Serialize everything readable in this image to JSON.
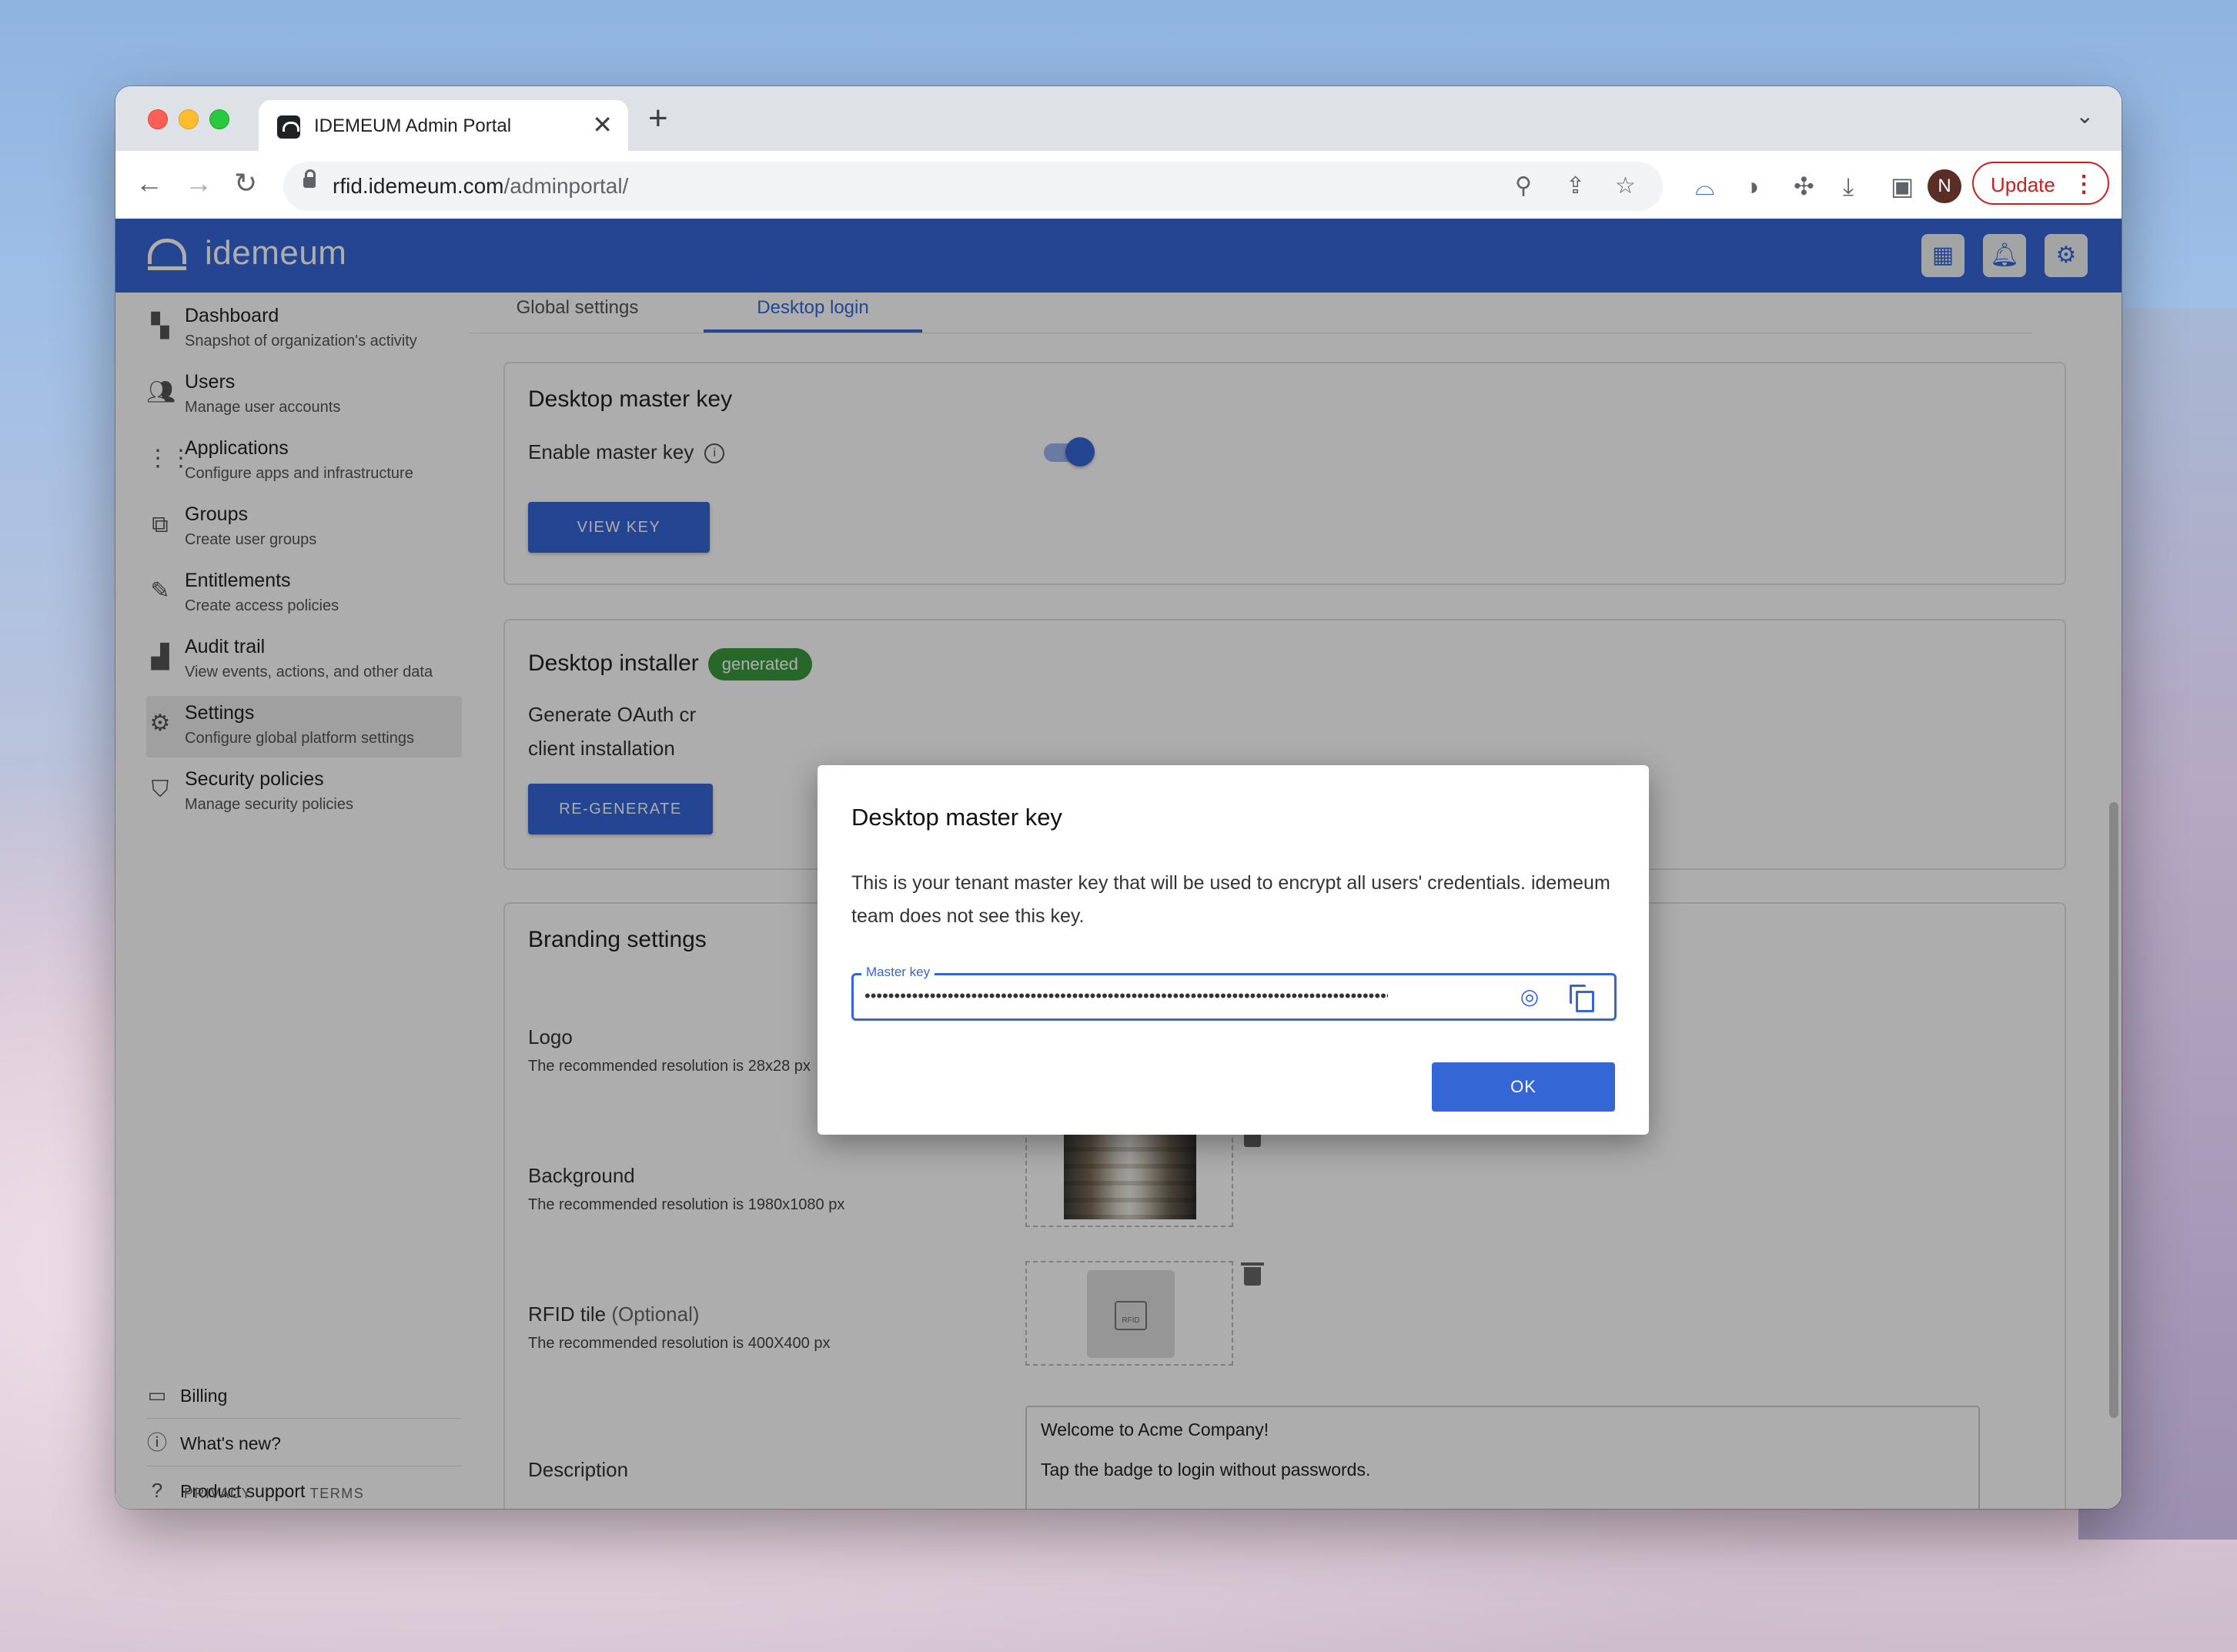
{
  "browser": {
    "tab_title": "IDEMEUM Admin Portal",
    "tab_close": "✕",
    "new_tab": "+",
    "tab_menu": "⌄",
    "url_host": "rfid.idemeum.com",
    "url_path": "/adminportal/",
    "profile_initial": "N",
    "update_label": "Update",
    "update_menu": "⋮"
  },
  "app": {
    "brand": "idemeum",
    "accent_color": "#3566d6"
  },
  "sidebar": {
    "items": [
      {
        "title": "Dashboard",
        "sub": "Snapshot of organization's activity",
        "icon": "dashboard-icon"
      },
      {
        "title": "Users",
        "sub": "Manage user accounts",
        "icon": "users-icon"
      },
      {
        "title": "Applications",
        "sub": "Configure apps and infrastructure",
        "icon": "apps-grid-icon"
      },
      {
        "title": "Groups",
        "sub": "Create user groups",
        "icon": "groups-icon"
      },
      {
        "title": "Entitlements",
        "sub": "Create access policies",
        "icon": "entitlements-icon"
      },
      {
        "title": "Audit trail",
        "sub": "View events, actions, and other data",
        "icon": "bar-chart-icon"
      },
      {
        "title": "Settings",
        "sub": "Configure global platform settings",
        "icon": "settings-icon"
      },
      {
        "title": "Security policies",
        "sub": "Manage security policies",
        "icon": "shield-icon"
      }
    ],
    "active_index": 6,
    "bottom_links": [
      "Billing",
      "What's new?",
      "Product support"
    ],
    "footer": [
      "PRIVACY",
      "TERMS"
    ]
  },
  "main": {
    "tabs": [
      "Global settings",
      "Desktop login"
    ],
    "active_tab": "Desktop login",
    "master_key_card": {
      "title": "Desktop master key",
      "enable_label": "Enable master key",
      "enabled": true,
      "button": "VIEW KEY"
    },
    "installer_card": {
      "title": "Desktop installer",
      "badge": "generated",
      "text_line1": "Generate OAuth cr",
      "text_line2": "client installation",
      "button": "RE-GENERATE"
    },
    "branding_card": {
      "title": "Branding settings",
      "logo_label": "Logo",
      "logo_hint": "The recommended resolution is 28x28 px",
      "background_label": "Background",
      "background_hint": "The recommended resolution is 1980x1080 px",
      "rfid_label": "RFID tile",
      "rfid_optional": "(Optional)",
      "rfid_hint": "The recommended resolution is 400X400 px",
      "description_label": "Description",
      "description_line1": "Welcome to Acme Company!",
      "description_line2": "Tap the badge to login without passwords."
    }
  },
  "dialog": {
    "title": "Desktop master key",
    "body": "This is your tenant master key that will be used to encrypt all users' credentials. idemeum team does not see this key.",
    "field_label": "Master key",
    "field_value": "••••••••••••••••••••••••••••••••••••••••••••••••••••••••••••••••••••••••••••••••••••••••••••••••",
    "ok": "OK"
  }
}
